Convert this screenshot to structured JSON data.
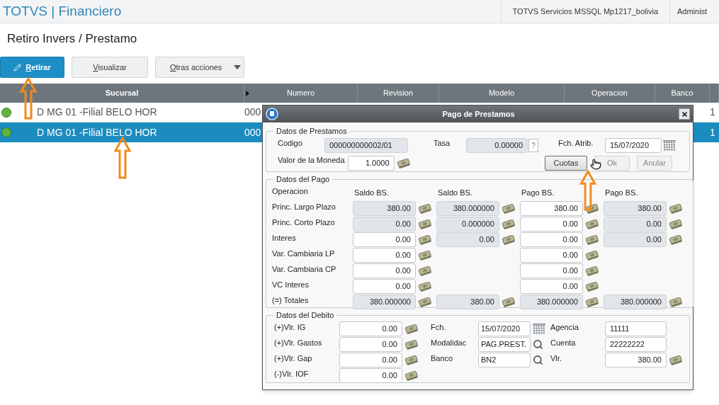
{
  "header": {
    "product": "TOTVS | Financiero",
    "environment": "TOTVS Servicios MSSQL Mp1217_bolivia",
    "user": "Administ"
  },
  "page_title": "Retiro Invers / Prestamo",
  "toolbar": [
    {
      "label": "Retirar",
      "kind": "primary"
    },
    {
      "label": "Visualizar",
      "kind": "plain"
    },
    {
      "label": "Otras acciones",
      "kind": "menu"
    }
  ],
  "table": {
    "columns": [
      "Sucursal",
      "Numero",
      "Revision",
      "Modelo",
      "Operacion",
      "Banco"
    ],
    "rows": [
      {
        "selected": false,
        "color": "#62b43a",
        "cells": [
          "D MG 01 -Filial BELO HOR",
          "000",
          null,
          null,
          null,
          null,
          "1"
        ]
      },
      {
        "selected": true,
        "color": "#62b43a",
        "cells": [
          "D MG 01 -Filial BELO HOR",
          "000",
          null,
          null,
          null,
          null,
          "1"
        ]
      }
    ]
  },
  "dialog": {
    "title": "Pago de Prestamos",
    "prestamos": {
      "legend": "Datos de Prestamos",
      "codigo": {
        "label": "Codigo",
        "value": "000000000002/01",
        "readonly": true
      },
      "tasa": {
        "label": "Tasa",
        "value": "0.00000",
        "readonly": true,
        "help": "?"
      },
      "fch_atrib": {
        "label": "Fch. Atrib.",
        "value": "15/07/2020",
        "readonly": false
      },
      "valor_moneda": {
        "label": "Valor de la Moneda",
        "value": "1.0000",
        "readonly": false
      },
      "buttons": [
        {
          "label": "Cuotas",
          "disabled": false
        },
        {
          "label": "Ok",
          "disabled": true
        },
        {
          "label": "Anular",
          "disabled": true
        }
      ]
    },
    "pago": {
      "legend": "Datos del Pago",
      "header_label": "Operacion",
      "columns": [
        "Saldo BS.",
        "Saldo BS.",
        "Pago BS.",
        "Pago BS."
      ],
      "rows": [
        {
          "label": "Princ. Largo Plazo",
          "cells": [
            {
              "value": "380.00",
              "readonly": true
            },
            {
              "value": "380.000000",
              "readonly": true
            },
            {
              "value": "380.00",
              "readonly": false
            },
            {
              "value": "380.00",
              "readonly": true
            }
          ]
        },
        {
          "label": "Princ. Corto Plazo",
          "cells": [
            {
              "value": "0.00",
              "readonly": true
            },
            {
              "value": "0.000000",
              "readonly": true
            },
            {
              "value": "0.00",
              "readonly": false
            },
            {
              "value": "0.00",
              "readonly": true
            }
          ]
        },
        {
          "label": "Interes",
          "cells": [
            {
              "value": "0.00",
              "readonly": false
            },
            {
              "value": "0.00",
              "readonly": true
            },
            {
              "value": "0.00",
              "readonly": false
            },
            {
              "value": "0.00",
              "readonly": true
            }
          ]
        },
        {
          "label": "Var. Cambiaria LP",
          "cells": [
            {
              "value": "0.00",
              "readonly": false
            },
            null,
            {
              "value": "0.00",
              "readonly": false
            },
            null
          ]
        },
        {
          "label": "Var. Cambiaria CP",
          "cells": [
            {
              "value": "0.00",
              "readonly": false
            },
            null,
            {
              "value": "0.00",
              "readonly": false
            },
            null
          ]
        },
        {
          "label": "VC Interes",
          "cells": [
            {
              "value": "0.00",
              "readonly": false
            },
            null,
            {
              "value": "0.00",
              "readonly": false
            },
            null
          ]
        },
        {
          "label": "(=) Totales",
          "cells": [
            {
              "value": "380.000000",
              "readonly": true
            },
            {
              "value": "380.00",
              "readonly": true
            },
            {
              "value": "380.000000",
              "readonly": true
            },
            {
              "value": "380.000000",
              "readonly": true
            }
          ]
        }
      ]
    },
    "debito": {
      "legend": "Datos del Debito",
      "columns": [
        [
          {
            "label": "(+)Vlr. IG",
            "value": "0.00",
            "readonly": false,
            "kind": "money"
          },
          {
            "label": "(+)Vlr. Gastos",
            "value": "0.00",
            "readonly": false,
            "kind": "money"
          },
          {
            "label": "(+)Vlr. Gap",
            "value": "0.00",
            "readonly": false,
            "kind": "money"
          },
          {
            "label": "(-)Vlr. IOF",
            "value": "0.00",
            "readonly": false,
            "kind": "money"
          }
        ],
        [
          {
            "label": "Fch.",
            "value": "15/07/2020",
            "readonly": false,
            "kind": "date"
          },
          {
            "label": "Modalidac",
            "value": "PAG.PREST.",
            "readonly": false,
            "kind": "lookup"
          },
          {
            "label": "Banco",
            "value": "BN2",
            "readonly": false,
            "kind": "lookup"
          }
        ],
        [
          {
            "label": "Agencia",
            "value": "11111",
            "readonly": false,
            "kind": "text"
          },
          {
            "label": "Cuenta",
            "value": "22222222",
            "readonly": false,
            "kind": "text"
          },
          {
            "label": "Vlr.",
            "value": "380.00",
            "readonly": false,
            "kind": "money"
          }
        ]
      ]
    }
  }
}
